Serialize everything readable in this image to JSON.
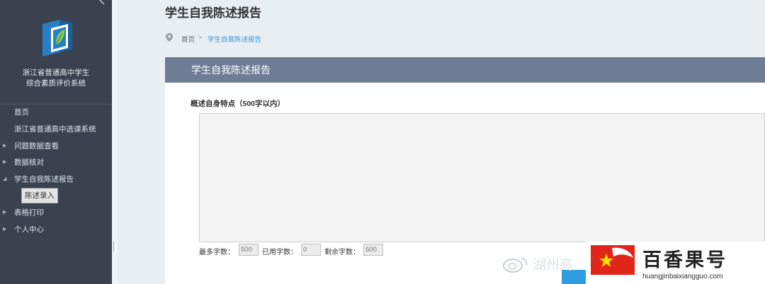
{
  "sidebar": {
    "system_name_line1": "浙江省普通高中学生",
    "system_name_line2": "综合素质评价系统",
    "items": [
      {
        "label": "首页",
        "arrow": ""
      },
      {
        "label": "浙江省普通高中选课系统",
        "arrow": ""
      },
      {
        "label": "问题数据查看",
        "arrow": "▶"
      },
      {
        "label": "数据核对",
        "arrow": "▶"
      },
      {
        "label": "学生自我陈述报告",
        "arrow": "◢"
      },
      {
        "label": "表格打印",
        "arrow": "▶"
      },
      {
        "label": "个人中心",
        "arrow": "▶"
      }
    ],
    "sub_item": "陈述录入"
  },
  "main": {
    "page_title": "学生自我陈述报告",
    "breadcrumb": {
      "home": "首页",
      "separator": ">",
      "current": "学生自我陈述报告"
    },
    "panel_title": "学生自我陈述报告",
    "field_label": "概述自身特点（500字以内）",
    "counts": {
      "max_label": "最多字数：",
      "max_value": "500",
      "used_label": "已用字数：",
      "used_value": "0",
      "remaining_label": "剩余字数：",
      "remaining_value": "500"
    }
  },
  "watermark": {
    "weibo_text": "湖州高",
    "brand_name": "百香果号",
    "brand_url": "huangjinbaixiangguo.com"
  },
  "colors": {
    "sidebar_bg": "#3a4250",
    "panel_header_bg": "#6e7c96",
    "breadcrumb_active": "#3a95d4",
    "accent_blue": "#2f9ee0",
    "flag_red": "#e0251b"
  }
}
